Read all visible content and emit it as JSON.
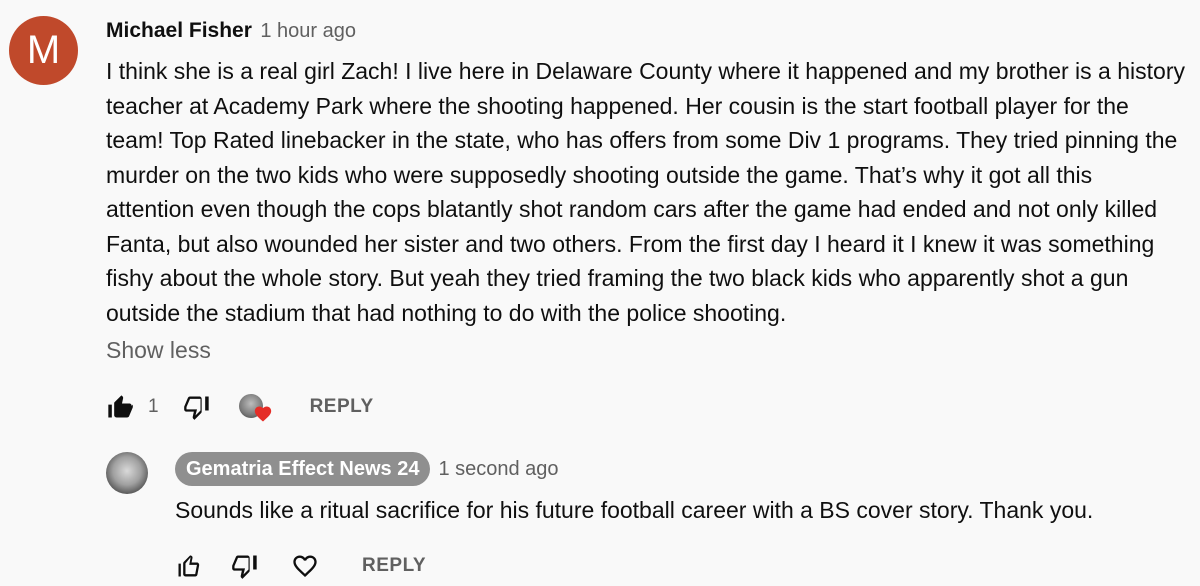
{
  "comment": {
    "avatar_letter": "M",
    "avatar_color": "#c0492b",
    "author": "Michael Fisher",
    "time": "1 hour ago",
    "text": "I think she is a real girl Zach! I live here in Delaware County where it happened and my brother is a history teacher at Academy Park where the shooting happened. Her cousin is the start football player for the team! Top Rated linebacker in the state, who has offers from some Div 1 programs. They tried pinning the murder on the two kids who were supposedly shooting outside the game. That’s why it got all this attention even though the cops blatantly shot random cars after the game had ended and not only killed Fanta, but also wounded her sister and two others. From the first day I heard it I knew it was something fishy about the whole story. But yeah they tried framing the two black kids who apparently shot a gun outside the stadium that had nothing to do with the police shooting.",
    "show_less": "Show less",
    "like_count": "1",
    "reply_label": "REPLY",
    "icons": {
      "like": "thumb-up-filled-icon",
      "dislike": "thumb-down-icon",
      "creator_heart": "creator-heart-icon"
    }
  },
  "reply": {
    "author": "Gematria Effect News 24",
    "time": "1 second ago",
    "text": "Sounds like a ritual sacrifice for his future football career with a BS cover story.  Thank you.",
    "reply_label": "REPLY",
    "icons": {
      "like": "thumb-up-icon",
      "dislike": "thumb-down-icon",
      "heart": "heart-outline-icon"
    }
  },
  "colors": {
    "background": "#f9f9f9",
    "text": "#0f0f0f",
    "secondary_text": "#606060",
    "heart": "#e52d27",
    "chip": "#8f8f8f"
  }
}
